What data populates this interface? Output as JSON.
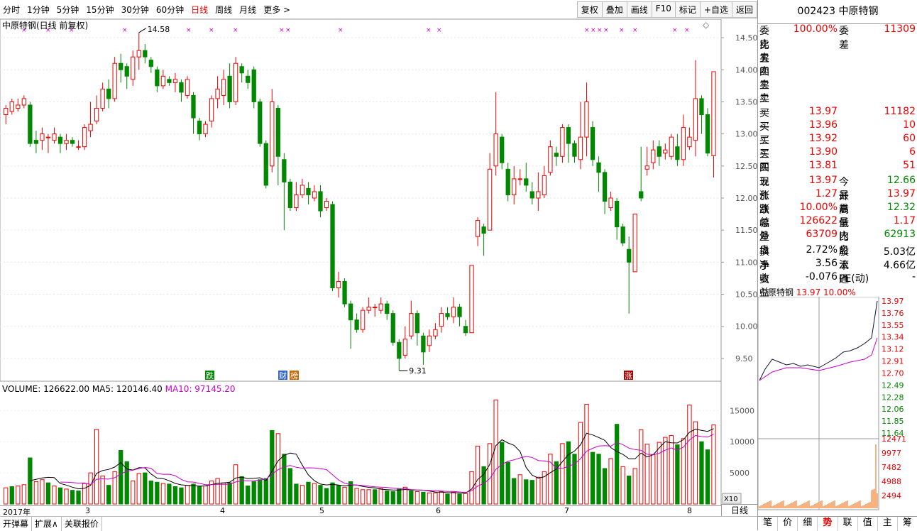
{
  "toolbar": {
    "periods": [
      "分时",
      "1分钟",
      "5分钟",
      "15分钟",
      "30分钟",
      "60分钟",
      "日线",
      "周线",
      "月线",
      "更多 >"
    ],
    "active": "日线",
    "buttons": [
      "复权",
      "叠加",
      "画线",
      "F10",
      "标记",
      "+自选",
      "返回"
    ]
  },
  "chart_title": "中原特钢(日线 前复权)",
  "price_axis": [
    "14.50",
    "14.00",
    "13.50",
    "13.00",
    "12.50",
    "12.00",
    "11.50",
    "11.00",
    "10.50",
    "10.00",
    "9.50"
  ],
  "annotations": {
    "high": "14.58",
    "low": "9.31",
    "tag_die": "跌",
    "tag_cai": "财",
    "tag_bang": "榜",
    "tag_zhang": "涨"
  },
  "volume_header": {
    "vol": "VOLUME: 126622.00",
    "ma5": "MA5: 120146.40",
    "ma10": "MA10: 97145.20"
  },
  "volume_axis": [
    "15000",
    "10000",
    "5000"
  ],
  "volume_unit": "X10",
  "x_labels": [
    "2017年",
    "3",
    "4",
    "5",
    "6",
    "7",
    "8"
  ],
  "period_label": "日线",
  "bottom_left": [
    "开弹幕",
    "扩展∧",
    "关联报价"
  ],
  "side": {
    "code": "002423  中原特钢",
    "weibi_k": "委比",
    "weibi_v": "100.00%",
    "weicha_k": "委差",
    "weicha_v": "11309",
    "sells": [
      [
        "卖五",
        "",
        ""
      ],
      [
        "卖四",
        "",
        ""
      ],
      [
        "卖三",
        "",
        ""
      ],
      [
        "卖二",
        "",
        ""
      ],
      [
        "卖一",
        "",
        ""
      ]
    ],
    "buys": [
      [
        "买一",
        "13.97",
        "11182"
      ],
      [
        "买二",
        "13.96",
        "10"
      ],
      [
        "买三",
        "13.92",
        "60"
      ],
      [
        "买四",
        "13.90",
        "6"
      ],
      [
        "买五",
        "13.81",
        "51"
      ]
    ],
    "stats": [
      [
        "现价",
        "13.97",
        "今开",
        "12.66"
      ],
      [
        "涨跌",
        "1.27",
        "最高",
        "13.97"
      ],
      [
        "涨幅",
        "10.00%",
        "最低",
        "12.32"
      ],
      [
        "总量",
        "126622",
        "量比",
        "1.17"
      ],
      [
        "外盘",
        "63709",
        "内盘",
        "62913"
      ],
      [
        "换手",
        "2.72%",
        "股本",
        "5.03亿"
      ],
      [
        "净资",
        "3.56",
        "流通",
        "4.66亿"
      ],
      [
        "收益(一)",
        "-0.076",
        "PE(动)",
        "-"
      ]
    ],
    "mini_title": "中原特钢",
    "mini_price": "13.97",
    "mini_pct": "10.00%",
    "mini_axis": [
      "13.97",
      "13.76",
      "13.55",
      "13.34",
      "13.12",
      "12.91",
      "12.70",
      "12.49",
      "12.28",
      "12.06",
      "11.85",
      "11.64"
    ],
    "mini_vol_axis": [
      "12471",
      "9977",
      "7482",
      "4988",
      "2494"
    ],
    "tabs": [
      "笔",
      "价",
      "细",
      "势",
      "联",
      "值",
      "主",
      "筹"
    ],
    "active_tab": "势"
  },
  "chart_data": {
    "type": "candlestick",
    "title": "中原特钢(日线 前复权)",
    "ylim": [
      9.2,
      14.7
    ],
    "candles": [
      [
        13.3,
        13.4,
        13.15,
        13.45
      ],
      [
        13.35,
        13.5,
        13.3,
        13.55
      ],
      [
        13.4,
        13.45,
        13.35,
        13.55
      ],
      [
        13.45,
        13.55,
        13.4,
        13.6
      ],
      [
        13.45,
        12.85,
        12.8,
        13.5
      ],
      [
        12.9,
        12.85,
        12.7,
        13.05
      ],
      [
        12.9,
        13.0,
        12.75,
        13.1
      ],
      [
        12.95,
        12.95,
        12.7,
        13.0
      ],
      [
        12.9,
        13.0,
        12.85,
        13.1
      ],
      [
        12.95,
        12.85,
        12.7,
        13.0
      ],
      [
        12.85,
        12.9,
        12.75,
        13.0
      ],
      [
        12.9,
        12.85,
        12.8,
        12.95
      ],
      [
        12.8,
        12.8,
        12.75,
        12.9
      ],
      [
        12.8,
        13.1,
        12.75,
        13.15
      ],
      [
        13.05,
        13.15,
        12.95,
        13.5
      ],
      [
        13.2,
        13.4,
        13.15,
        13.6
      ],
      [
        13.4,
        13.7,
        13.35,
        13.8
      ],
      [
        13.7,
        13.55,
        13.4,
        13.85
      ],
      [
        13.55,
        14.1,
        13.5,
        14.2
      ],
      [
        14.1,
        14.0,
        13.8,
        14.25
      ],
      [
        14.05,
        13.9,
        13.7,
        14.1
      ],
      [
        13.85,
        14.2,
        13.75,
        14.3
      ],
      [
        14.2,
        14.3,
        14.0,
        14.58
      ],
      [
        14.3,
        14.2,
        14.1,
        14.4
      ],
      [
        14.15,
        14.05,
        13.95,
        14.2
      ],
      [
        14.0,
        13.75,
        13.65,
        14.05
      ],
      [
        13.75,
        13.9,
        13.7,
        14.0
      ],
      [
        13.85,
        13.8,
        13.75,
        13.9
      ],
      [
        13.8,
        13.85,
        13.65,
        13.95
      ],
      [
        13.8,
        13.65,
        13.5,
        13.85
      ],
      [
        13.6,
        13.85,
        13.55,
        13.9
      ],
      [
        13.6,
        13.25,
        13.0,
        13.65
      ],
      [
        13.2,
        13.0,
        12.9,
        13.25
      ],
      [
        13.0,
        13.15,
        12.95,
        13.2
      ],
      [
        13.2,
        13.55,
        13.1,
        13.6
      ],
      [
        13.55,
        13.7,
        13.4,
        13.9
      ],
      [
        13.6,
        13.85,
        13.45,
        14.0
      ],
      [
        13.9,
        13.5,
        13.4,
        14.1
      ],
      [
        13.5,
        14.1,
        13.45,
        14.2
      ],
      [
        14.05,
        13.95,
        13.8,
        14.1
      ],
      [
        13.9,
        13.8,
        13.7,
        14.0
      ],
      [
        14.0,
        13.5,
        13.4,
        14.05
      ],
      [
        13.5,
        12.85,
        12.8,
        13.55
      ],
      [
        12.85,
        12.2,
        12.15,
        12.9
      ],
      [
        12.5,
        13.5,
        12.4,
        13.7
      ],
      [
        13.4,
        12.65,
        12.2,
        13.45
      ],
      [
        12.6,
        12.25,
        11.5,
        12.7
      ],
      [
        12.25,
        11.85,
        11.8,
        12.3
      ],
      [
        11.85,
        12.05,
        11.8,
        12.25
      ],
      [
        12.05,
        12.2,
        12.0,
        12.3
      ],
      [
        12.15,
        12.05,
        11.9,
        12.25
      ],
      [
        12.0,
        12.1,
        11.95,
        12.2
      ],
      [
        12.1,
        11.8,
        11.7,
        12.2
      ],
      [
        11.85,
        11.95,
        11.8,
        12.0
      ],
      [
        11.9,
        10.6,
        10.55,
        11.95
      ],
      [
        10.6,
        10.7,
        10.45,
        10.85
      ],
      [
        10.7,
        10.35,
        10.3,
        10.75
      ],
      [
        10.35,
        10.1,
        9.65,
        10.4
      ],
      [
        10.1,
        9.95,
        9.9,
        10.2
      ],
      [
        9.95,
        10.25,
        9.9,
        10.3
      ],
      [
        10.25,
        10.3,
        10.2,
        10.45
      ],
      [
        10.3,
        10.3,
        10.15,
        10.35
      ],
      [
        10.25,
        10.35,
        10.2,
        10.45
      ],
      [
        10.35,
        10.2,
        10.1,
        10.4
      ],
      [
        10.2,
        9.75,
        9.7,
        10.25
      ],
      [
        9.75,
        9.5,
        9.31,
        9.8
      ],
      [
        9.55,
        9.8,
        9.5,
        10.0
      ],
      [
        9.85,
        10.2,
        9.8,
        10.4
      ],
      [
        10.2,
        9.9,
        9.7,
        10.25
      ],
      [
        9.85,
        9.6,
        9.4,
        9.9
      ],
      [
        9.7,
        9.85,
        9.6,
        9.95
      ],
      [
        9.85,
        9.95,
        9.8,
        10.05
      ],
      [
        10.0,
        10.2,
        9.9,
        10.3
      ],
      [
        10.2,
        10.15,
        10.1,
        10.3
      ],
      [
        10.15,
        10.3,
        10.05,
        10.45
      ],
      [
        10.3,
        10.15,
        10.0,
        10.35
      ],
      [
        10.0,
        9.9,
        9.85,
        10.1
      ],
      [
        9.9,
        10.95,
        9.9,
        10.95
      ],
      [
        11.4,
        11.65,
        11.25,
        11.7
      ],
      [
        11.55,
        11.45,
        11.1,
        11.6
      ],
      [
        11.5,
        12.45,
        11.5,
        12.7
      ],
      [
        12.5,
        13.0,
        12.35,
        13.65
      ],
      [
        12.95,
        12.55,
        12.45,
        13.0
      ],
      [
        12.45,
        12.05,
        11.95,
        12.55
      ],
      [
        12.05,
        12.3,
        11.9,
        12.5
      ],
      [
        12.3,
        12.3,
        12.2,
        12.45
      ],
      [
        12.3,
        12.2,
        12.1,
        12.55
      ],
      [
        12.1,
        12.0,
        11.9,
        12.25
      ],
      [
        12.0,
        12.1,
        11.8,
        12.4
      ],
      [
        12.05,
        12.35,
        12.0,
        12.5
      ],
      [
        12.4,
        12.8,
        12.35,
        12.9
      ],
      [
        12.7,
        12.65,
        12.5,
        12.8
      ],
      [
        12.65,
        13.1,
        12.55,
        13.15
      ],
      [
        13.1,
        12.85,
        12.55,
        13.15
      ],
      [
        12.85,
        12.65,
        12.55,
        12.9
      ],
      [
        12.6,
        12.95,
        12.45,
        13.5
      ],
      [
        12.95,
        13.5,
        12.65,
        13.8
      ],
      [
        13.1,
        12.6,
        12.5,
        13.2
      ],
      [
        12.55,
        12.4,
        12.1,
        12.65
      ],
      [
        12.4,
        11.95,
        11.75,
        12.45
      ],
      [
        11.85,
        12.0,
        11.8,
        12.1
      ],
      [
        11.95,
        11.55,
        11.35,
        12.0
      ],
      [
        11.55,
        11.3,
        11.25,
        11.6
      ],
      [
        11.2,
        11.0,
        10.2,
        11.4
      ],
      [
        10.85,
        11.75,
        10.85,
        11.75
      ],
      [
        12.1,
        12.0,
        11.95,
        12.8
      ],
      [
        12.45,
        12.5,
        12.35,
        12.8
      ],
      [
        12.55,
        12.75,
        12.45,
        12.9
      ],
      [
        12.8,
        12.65,
        12.5,
        12.9
      ],
      [
        12.7,
        12.75,
        12.6,
        12.85
      ],
      [
        12.65,
        12.95,
        12.6,
        13.0
      ],
      [
        12.8,
        12.6,
        12.5,
        13.0
      ],
      [
        12.6,
        13.1,
        12.5,
        13.3
      ],
      [
        12.8,
        12.95,
        12.75,
        13.1
      ],
      [
        12.9,
        13.55,
        12.65,
        14.15
      ],
      [
        13.55,
        13.3,
        13.0,
        13.6
      ],
      [
        13.3,
        12.7,
        12.65,
        13.4
      ],
      [
        12.66,
        13.97,
        12.32,
        13.97
      ]
    ],
    "volume": {
      "ma5": 120146.4,
      "ma10": 97145.2,
      "last": 126622.0,
      "bars": [
        [
          2600,
          1
        ],
        [
          2800,
          0
        ],
        [
          2900,
          1
        ],
        [
          3100,
          1
        ],
        [
          7400,
          0
        ],
        [
          3600,
          1
        ],
        [
          3900,
          1
        ],
        [
          3400,
          0
        ],
        [
          2900,
          1
        ],
        [
          2600,
          0
        ],
        [
          2400,
          1
        ],
        [
          2200,
          0
        ],
        [
          2100,
          0
        ],
        [
          3300,
          1
        ],
        [
          5000,
          1
        ],
        [
          12000,
          1
        ],
        [
          4500,
          1
        ],
        [
          3000,
          0
        ],
        [
          5200,
          1
        ],
        [
          8600,
          0
        ],
        [
          6800,
          0
        ],
        [
          3700,
          1
        ],
        [
          4900,
          1
        ],
        [
          5000,
          0
        ],
        [
          3700,
          0
        ],
        [
          3500,
          0
        ],
        [
          3300,
          1
        ],
        [
          3200,
          0
        ],
        [
          2800,
          0
        ],
        [
          2600,
          0
        ],
        [
          3000,
          1
        ],
        [
          3200,
          0
        ],
        [
          2800,
          0
        ],
        [
          2900,
          1
        ],
        [
          3700,
          1
        ],
        [
          4100,
          1
        ],
        [
          3400,
          1
        ],
        [
          3400,
          0
        ],
        [
          6300,
          1
        ],
        [
          4400,
          0
        ],
        [
          2900,
          0
        ],
        [
          3600,
          0
        ],
        [
          3900,
          0
        ],
        [
          4100,
          0
        ],
        [
          11800,
          0
        ],
        [
          11300,
          1
        ],
        [
          8000,
          0
        ],
        [
          5700,
          0
        ],
        [
          3200,
          0
        ],
        [
          3000,
          1
        ],
        [
          3500,
          0
        ],
        [
          3300,
          1
        ],
        [
          3000,
          0
        ],
        [
          2500,
          0
        ],
        [
          3400,
          0
        ],
        [
          3000,
          0
        ],
        [
          2700,
          1
        ],
        [
          3600,
          0
        ],
        [
          2500,
          1
        ],
        [
          2300,
          1
        ],
        [
          2300,
          1
        ],
        [
          2300,
          0
        ],
        [
          2500,
          1
        ],
        [
          2100,
          0
        ],
        [
          2000,
          0
        ],
        [
          2400,
          0
        ],
        [
          2700,
          1
        ],
        [
          2100,
          0
        ],
        [
          2000,
          1
        ],
        [
          1900,
          0
        ],
        [
          1800,
          1
        ],
        [
          1800,
          1
        ],
        [
          2000,
          1
        ],
        [
          1600,
          0
        ],
        [
          1900,
          1
        ],
        [
          1600,
          0
        ],
        [
          1700,
          1
        ],
        [
          5200,
          1
        ],
        [
          9300,
          1
        ],
        [
          6000,
          0
        ],
        [
          9700,
          1
        ],
        [
          16700,
          1
        ],
        [
          9900,
          0
        ],
        [
          6700,
          0
        ],
        [
          4100,
          0
        ],
        [
          4700,
          1
        ],
        [
          3900,
          0
        ],
        [
          3800,
          0
        ],
        [
          4300,
          1
        ],
        [
          5200,
          1
        ],
        [
          8000,
          1
        ],
        [
          6800,
          0
        ],
        [
          9700,
          1
        ],
        [
          10000,
          0
        ],
        [
          8000,
          0
        ],
        [
          13100,
          1
        ],
        [
          16000,
          1
        ],
        [
          8300,
          0
        ],
        [
          8000,
          0
        ],
        [
          5700,
          0
        ],
        [
          7300,
          1
        ],
        [
          12800,
          0
        ],
        [
          6000,
          1
        ],
        [
          4500,
          0
        ],
        [
          5700,
          1
        ],
        [
          11900,
          1
        ],
        [
          9600,
          1
        ],
        [
          7900,
          1
        ],
        [
          9900,
          1
        ],
        [
          10700,
          1
        ],
        [
          11000,
          1
        ],
        [
          9500,
          0
        ],
        [
          10500,
          1
        ],
        [
          15900,
          1
        ],
        [
          13200,
          1
        ],
        [
          10000,
          0
        ],
        [
          8700,
          0
        ],
        [
          12700,
          1
        ]
      ]
    }
  }
}
